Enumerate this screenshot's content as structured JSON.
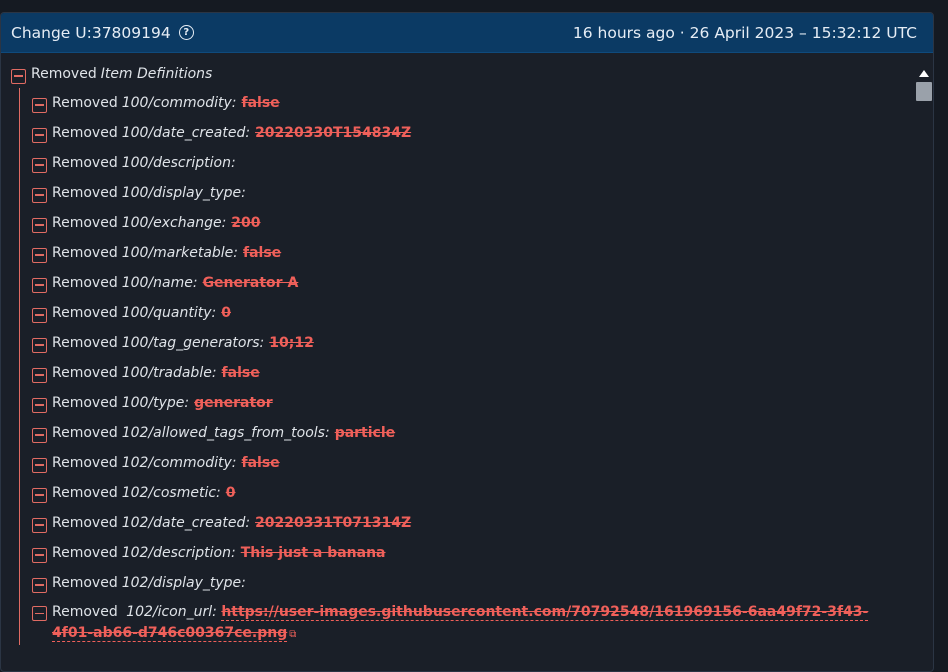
{
  "header": {
    "title": "Change U:37809194",
    "timestamp": "16 hours ago · 26 April 2023 – 15:32:12 UTC"
  },
  "root": {
    "action": "Removed",
    "label": "Item Definitions"
  },
  "items": [
    {
      "action": "Removed",
      "key": "100/commodity:",
      "value": "false"
    },
    {
      "action": "Removed",
      "key": "100/date_created:",
      "value": "20220330T154834Z"
    },
    {
      "action": "Removed",
      "key": "100/description:",
      "value": ""
    },
    {
      "action": "Removed",
      "key": "100/display_type:",
      "value": ""
    },
    {
      "action": "Removed",
      "key": "100/exchange:",
      "value": "200"
    },
    {
      "action": "Removed",
      "key": "100/marketable:",
      "value": "false"
    },
    {
      "action": "Removed",
      "key": "100/name:",
      "value": "Generator A"
    },
    {
      "action": "Removed",
      "key": "100/quantity:",
      "value": "0"
    },
    {
      "action": "Removed",
      "key": "100/tag_generators:",
      "value": "10;12"
    },
    {
      "action": "Removed",
      "key": "100/tradable:",
      "value": "false"
    },
    {
      "action": "Removed",
      "key": "100/type:",
      "value": "generator"
    },
    {
      "action": "Removed",
      "key": "102/allowed_tags_from_tools:",
      "value": "particle"
    },
    {
      "action": "Removed",
      "key": "102/commodity:",
      "value": "false"
    },
    {
      "action": "Removed",
      "key": "102/cosmetic:",
      "value": "0"
    },
    {
      "action": "Removed",
      "key": "102/date_created:",
      "value": "20220331T071314Z"
    },
    {
      "action": "Removed",
      "key": "102/description:",
      "value": "This just a banana"
    },
    {
      "action": "Removed",
      "key": "102/display_type:",
      "value": ""
    }
  ],
  "icon_url_item": {
    "action": "Removed",
    "key": "102/icon_url:",
    "value": "https://user-images.githubusercontent.com/70792548/161969156-6aa49f72-3f43-4f01-ab66-d746c00367ce.png"
  },
  "icons": {
    "help": "?",
    "external_link": "external-link-icon",
    "collapse": "minus-square-icon"
  },
  "colors": {
    "header_bg": "#0b3a64",
    "removed": "#f0605a",
    "tree_line": "#e06b63",
    "panel_bg": "#1a1f28"
  }
}
